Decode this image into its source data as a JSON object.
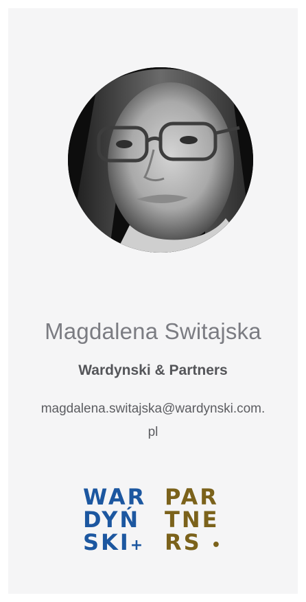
{
  "profile": {
    "name": "Magdalena Switajska",
    "company": "Wardynski & Partners",
    "email": "magdalena.switajska@wardynski.com.pl",
    "photo_icon": "portrait-photo"
  },
  "logo": {
    "blue_lines": [
      "WAR",
      "DYŃ",
      "SKI"
    ],
    "blue_mark": "+",
    "gold_lines": [
      "PAR",
      "TNE",
      "RS"
    ],
    "gold_mark": "•",
    "colors": {
      "blue": "#1c57a0",
      "gold": "#7b621b"
    }
  },
  "colors": {
    "card_background": "#f5f5f6",
    "name_text": "#7b7c82",
    "company_text": "#545559"
  }
}
